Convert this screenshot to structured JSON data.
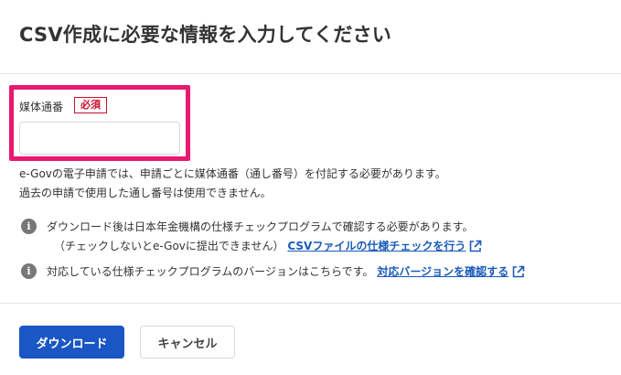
{
  "dialog": {
    "title": "CSV作成に必要な情報を入力してください"
  },
  "field": {
    "label": "媒体通番",
    "required_badge": "必須",
    "value": "",
    "placeholder": ""
  },
  "help": {
    "line1": "e-Govの電子申請では、申請ごとに媒体通番（通し番号）を付記する必要があります。",
    "line2": "過去の申請で使用した通し番号は使用できません。"
  },
  "info": [
    {
      "icon": "info-icon",
      "text_line1": "ダウンロード後は日本年金機構の仕様チェックプログラムで確認する必要があります。",
      "text_line2": "（チェックしないとe-Govに提出できません）",
      "link_label": "CSVファイルの仕様チェックを行う",
      "link_icon": "external-link-icon"
    },
    {
      "icon": "info-icon",
      "text_line1": "対応している仕様チェックプログラムのバージョンはこちらです。",
      "link_label": "対応バージョンを確認する",
      "link_icon": "external-link-icon"
    }
  ],
  "buttons": {
    "download_label": "ダウンロード",
    "cancel_label": "キャンセル"
  },
  "colors": {
    "highlight": "#e8196f",
    "required": "#c8102e",
    "primary": "#1a56c4",
    "link": "#1a5bb8"
  }
}
